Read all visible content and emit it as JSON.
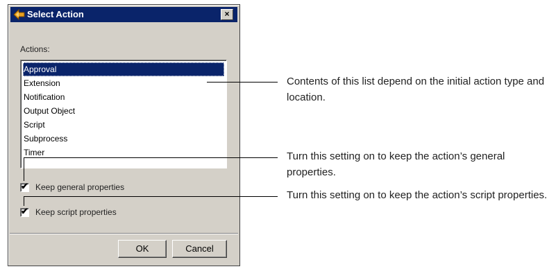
{
  "dialog": {
    "title": "Select Action",
    "close_label": "×",
    "actions_label": "Actions:",
    "actions": [
      "Approval",
      "Extension",
      "Notification",
      "Output Object",
      "Script",
      "Subprocess",
      "Timer"
    ],
    "selected_action": "Approval",
    "keep_general": {
      "label": "Keep general properties",
      "checked": true
    },
    "keep_script": {
      "label": "Keep script properties",
      "checked": true
    },
    "ok_label": "OK",
    "cancel_label": "Cancel"
  },
  "callouts": {
    "list": "Contents of this list depend on the initial action type and location.",
    "general": "Turn this setting on to keep the action’s general properties.",
    "script": "Turn this setting on to keep the action’s script properties."
  }
}
